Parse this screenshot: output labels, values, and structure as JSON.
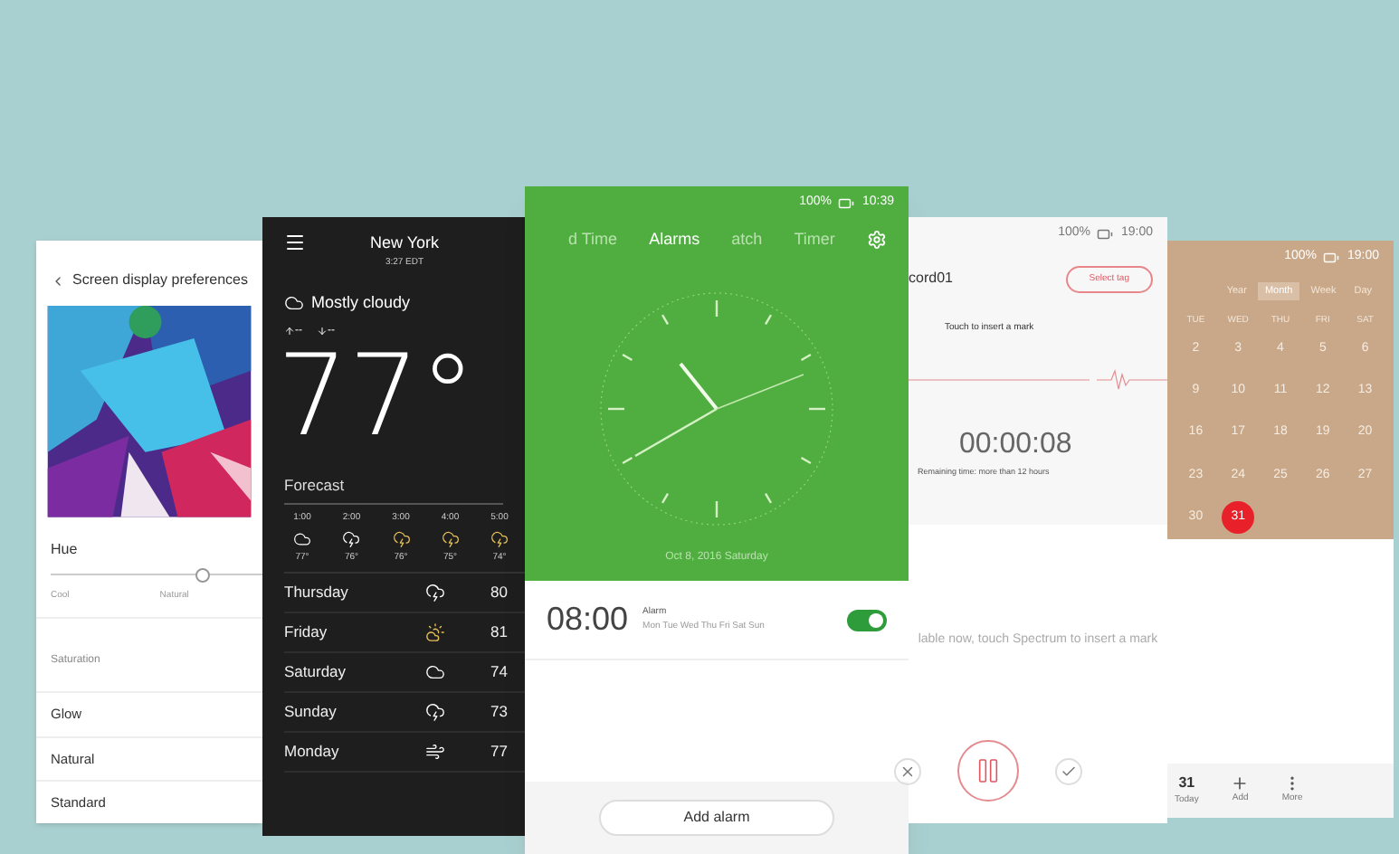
{
  "settings": {
    "title": "Screen display preferences",
    "hue": {
      "label": "Hue",
      "level": 0.72,
      "left": "Cool",
      "middle": "Natural"
    },
    "section": "Saturation",
    "options": [
      "Glow",
      "Natural",
      "Standard"
    ]
  },
  "weather": {
    "city": "New York",
    "time": "3:27 EDT",
    "condition": "Mostly cloudy",
    "high": "--",
    "low": "--",
    "temperature": "77°",
    "forecast_label": "Forecast",
    "hourly": [
      {
        "time": "1:00",
        "kind": "cloud",
        "temp": "77°"
      },
      {
        "time": "2:00",
        "kind": "storm",
        "temp": "76°"
      },
      {
        "time": "3:00",
        "kind": "sunstorm",
        "temp": "76°"
      },
      {
        "time": "4:00",
        "kind": "sunstorm",
        "temp": "75°"
      },
      {
        "time": "5:00",
        "kind": "sunstorm",
        "temp": "74°"
      }
    ],
    "daily": [
      {
        "day": "Thursday",
        "kind": "storm",
        "high": "80"
      },
      {
        "day": "Friday",
        "kind": "sun",
        "high": "81"
      },
      {
        "day": "Saturday",
        "kind": "cloud",
        "high": "74"
      },
      {
        "day": "Sunday",
        "kind": "storm",
        "high": "73"
      },
      {
        "day": "Monday",
        "kind": "wind",
        "high": "77"
      }
    ]
  },
  "clock": {
    "battery": "100%",
    "time": "10:39",
    "tabs": [
      {
        "label": "d Time",
        "selected": false
      },
      {
        "label": "Alarms",
        "selected": true
      },
      {
        "label": "atch",
        "selected": false
      },
      {
        "label": "Timer",
        "selected": false
      }
    ],
    "date": "Oct 8, 2016  Saturday",
    "alarms": [
      {
        "time": "08:00",
        "label": "Alarm",
        "days": "Mon Tue Wed Thu Fri Sat Sun",
        "on": true
      }
    ],
    "add_button": "Add alarm"
  },
  "recorder": {
    "battery": "100%",
    "time": "19:00",
    "name": "cord01",
    "tag_button": "Select tag",
    "hint": "Touch to insert a mark",
    "elapsed": "00:00:08",
    "remaining": "Remaining time: more than 12 hours",
    "message": "lable now, touch Spectrum to insert a mark"
  },
  "calendar": {
    "battery": "100%",
    "time": "19:00",
    "views": [
      {
        "label": "Year",
        "selected": false
      },
      {
        "label": "Month",
        "selected": true
      },
      {
        "label": "Week",
        "selected": false
      },
      {
        "label": "Day",
        "selected": false
      }
    ],
    "weekdays": [
      "TUE",
      "WED",
      "THU",
      "FRI",
      "SAT"
    ],
    "weeks": [
      [
        {
          "day": "2",
          "selected": false
        },
        {
          "day": "3",
          "selected": false
        },
        {
          "day": "4",
          "selected": false
        },
        {
          "day": "5",
          "selected": false
        },
        {
          "day": "6",
          "selected": false
        }
      ],
      [
        {
          "day": "9",
          "selected": false
        },
        {
          "day": "10",
          "selected": false
        },
        {
          "day": "11",
          "selected": false
        },
        {
          "day": "12",
          "selected": false
        },
        {
          "day": "13",
          "selected": false
        }
      ],
      [
        {
          "day": "16",
          "selected": false
        },
        {
          "day": "17",
          "selected": false
        },
        {
          "day": "18",
          "selected": false
        },
        {
          "day": "19",
          "selected": false
        },
        {
          "day": "20",
          "selected": false
        }
      ],
      [
        {
          "day": "23",
          "selected": false
        },
        {
          "day": "24",
          "selected": false
        },
        {
          "day": "25",
          "selected": false
        },
        {
          "day": "26",
          "selected": false
        },
        {
          "day": "27",
          "selected": false
        }
      ],
      [
        {
          "day": "30",
          "selected": false
        },
        {
          "day": "31",
          "selected": true
        }
      ]
    ],
    "toolbar": [
      {
        "kind": "today",
        "icon_text": "31",
        "label": "Today"
      },
      {
        "kind": "add",
        "label": "Add"
      },
      {
        "kind": "more",
        "label": "More"
      }
    ]
  }
}
